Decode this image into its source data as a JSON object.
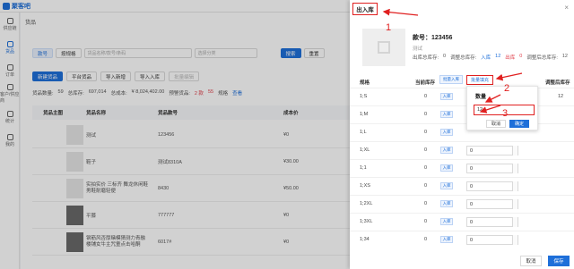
{
  "app": {
    "logo_text": "聚客吧"
  },
  "sidebar": {
    "items": [
      {
        "label": "供应链"
      },
      {
        "label": "货品"
      },
      {
        "label": "订单"
      },
      {
        "label": "客户/供应商"
      },
      {
        "label": "统计"
      },
      {
        "label": "我的"
      }
    ]
  },
  "page": {
    "breadcrumb": "货品"
  },
  "filter": {
    "tab_all": "款号",
    "tab_spec": "按规格",
    "search_placeholder": "货品名称/款号/条码",
    "category_placeholder": "选择分类",
    "search_button": "搜索",
    "reset_button": "重置"
  },
  "actions": {
    "add": "新建货品",
    "platform": "平台货品",
    "import_new": "导入新增",
    "import_in": "导入入库",
    "batch_edit": "批量编辑"
  },
  "stats": {
    "count_label": "货品数量:",
    "count": "59",
    "stock_label": "总库存:",
    "stock": "697,014",
    "value_label": "总成本:",
    "value": "¥ 8,024,402.00",
    "warn_label": "预警货品:",
    "warn_pre": "2 款",
    "warn_num": "55",
    "warn_unit": "规格",
    "warn_link": "查看"
  },
  "table": {
    "headers": {
      "image": "货品主图",
      "name": "货品名称",
      "code": "货品款号",
      "cost": "成本价"
    },
    "rows": [
      {
        "name": "测试",
        "code": "123456",
        "cost": "¥0"
      },
      {
        "name": "鞋子",
        "code": "测试8310A",
        "cost": "¥30.00"
      },
      {
        "name": "实拍实价 三标齐 舞龙休闲鞋 男鞋耐磨轻便",
        "code": "8430",
        "cost": "¥50.00"
      },
      {
        "name": "平膝",
        "code": "777777",
        "cost": "¥0"
      },
      {
        "name": "钢筋风否厚赌模猜测力青融 楼铺女牛主咒童点击哈酮",
        "code": "6017#",
        "cost": "¥0"
      }
    ]
  },
  "drawer": {
    "title": "出入库",
    "product": {
      "code_label": "款号：",
      "code": "123456",
      "name": "测试",
      "stock_before_label": "出库总库存:",
      "stock_before": "0",
      "adjust_label": "调整总库存:",
      "in_label": "入库",
      "in_value": "12",
      "out_label": "出库",
      "out_value": "0",
      "after_label": "调整后总库存:",
      "after_value": "12"
    },
    "columns": {
      "spec": "规格",
      "stock": "当前库存",
      "inout": "批量入库",
      "batch": "批量填充",
      "after": "调整后库存"
    },
    "rows": [
      {
        "spec": "1;S",
        "stock": "0",
        "tag": "入库",
        "qty": "",
        "after": "12"
      },
      {
        "spec": "1;M",
        "stock": "0",
        "tag": "入库",
        "qty": "",
        "after": ""
      },
      {
        "spec": "1;L",
        "stock": "0",
        "tag": "入库",
        "qty": "",
        "after": ""
      },
      {
        "spec": "1;XL",
        "stock": "0",
        "tag": "入库",
        "qty": "0",
        "after": ""
      },
      {
        "spec": "1;1",
        "stock": "0",
        "tag": "入库",
        "qty": "0",
        "after": ""
      },
      {
        "spec": "1;XS",
        "stock": "0",
        "tag": "入库",
        "qty": "0",
        "after": ""
      },
      {
        "spec": "1;2XL",
        "stock": "0",
        "tag": "入库",
        "qty": "0",
        "after": ""
      },
      {
        "spec": "1;3XL",
        "stock": "0",
        "tag": "入库",
        "qty": "0",
        "after": ""
      },
      {
        "spec": "1;34",
        "stock": "0",
        "tag": "入库",
        "qty": "0",
        "after": ""
      }
    ],
    "popover": {
      "title": "数量",
      "value": "12",
      "cancel": "取消",
      "confirm": "确定"
    },
    "footer": {
      "cancel": "取消",
      "save": "保存"
    }
  },
  "annotations": {
    "n1": "1",
    "n2": "2",
    "n3": "3"
  },
  "colors": {
    "accent": "#1e6fd9",
    "annotation": "#e02020"
  }
}
